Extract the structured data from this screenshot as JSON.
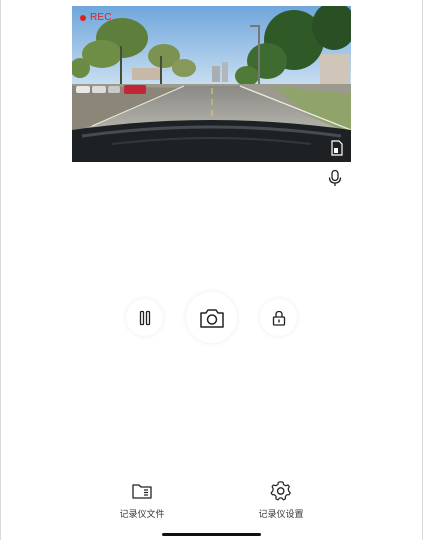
{
  "preview": {
    "rec_label": "REC",
    "rec_color": "#e02020"
  },
  "icons": {
    "fullscreen": "fullscreen-icon",
    "mic": "mic-icon",
    "pause": "pause-icon",
    "camera": "camera-icon",
    "lock": "lock-icon",
    "folder": "folder-icon",
    "gear": "gear-icon"
  },
  "controls": {
    "pause": "pause",
    "capture": "capture",
    "lock": "lock"
  },
  "bottom_nav": {
    "items": [
      {
        "label": "记录仪文件",
        "icon": "folder-icon"
      },
      {
        "label": "记录仪设置",
        "icon": "gear-icon"
      }
    ]
  }
}
